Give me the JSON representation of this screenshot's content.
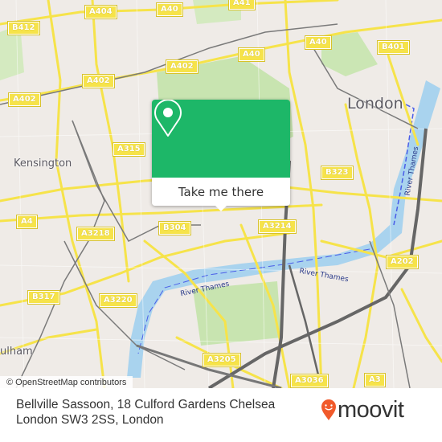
{
  "map": {
    "place_labels": [
      {
        "name": "London",
        "size": "large"
      },
      {
        "name": "Kensington",
        "size": "medium"
      },
      {
        "name": "ulham",
        "size": "medium"
      }
    ],
    "road_shields": [
      "A404",
      "A40",
      "A41",
      "B412",
      "A402",
      "A402",
      "A402",
      "A40",
      "A40",
      "B401",
      "A315",
      "A4",
      "A3218",
      "B304",
      "B323",
      "A3214",
      "A202",
      "B317",
      "A3220",
      "A3205",
      "A3036",
      "A3"
    ],
    "river_labels": [
      "River Thames",
      "River Thames",
      "River Thames"
    ],
    "colors": {
      "land": "#efebe7",
      "park": "#c8e4b0",
      "water": "#a9d3ee",
      "road": "#f6e34a",
      "rail": "#7a7a7a"
    }
  },
  "popup": {
    "icon": "location-pin-icon",
    "button_label": "Take me there",
    "color": "#1db768"
  },
  "attribution": "© OpenStreetMap contributors",
  "footer": {
    "address_line1": "Bellville Sassoon, 18 Culford Gardens Chelsea",
    "address_line2": "London SW3 2SS, London",
    "brand_name": "moovit",
    "brand_color": "#f15a2b"
  }
}
